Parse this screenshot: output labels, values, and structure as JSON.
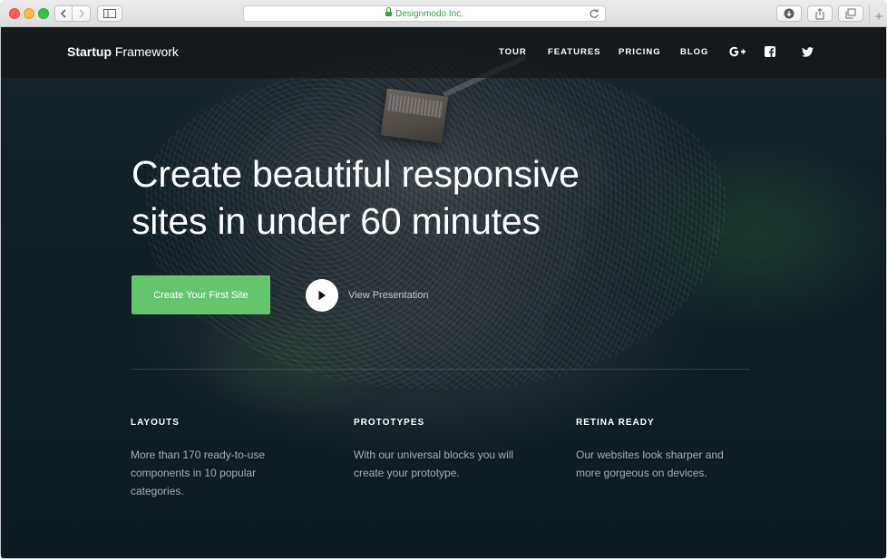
{
  "browser": {
    "address_url": "Designmodo Inc."
  },
  "nav": {
    "brand_bold": "Startup",
    "brand_rest": " Framework",
    "items": [
      {
        "label": "TOUR"
      },
      {
        "label": "FEATURES"
      },
      {
        "label": "PRICING"
      },
      {
        "label": "BLOG"
      }
    ],
    "social_icons": [
      "google-plus-icon",
      "facebook-icon",
      "twitter-icon"
    ]
  },
  "hero": {
    "headline_line1": "Create beautiful responsive",
    "headline_line2": "sites in under 60 minutes",
    "cta_label": "Create Your First Site",
    "video_label": "View Presentation"
  },
  "features": [
    {
      "title": "LAYOUTS",
      "text": "More than 170 ready-to-use components in 10 popular categories."
    },
    {
      "title": "PROTOTYPES",
      "text": "With our universal blocks you will create your prototype."
    },
    {
      "title": "RETINA READY",
      "text": "Our websites look sharper and more gorgeous on devices."
    }
  ],
  "colors": {
    "accent_green": "#65c56d",
    "secure_green": "#34a245",
    "nav_background": "#161616"
  }
}
